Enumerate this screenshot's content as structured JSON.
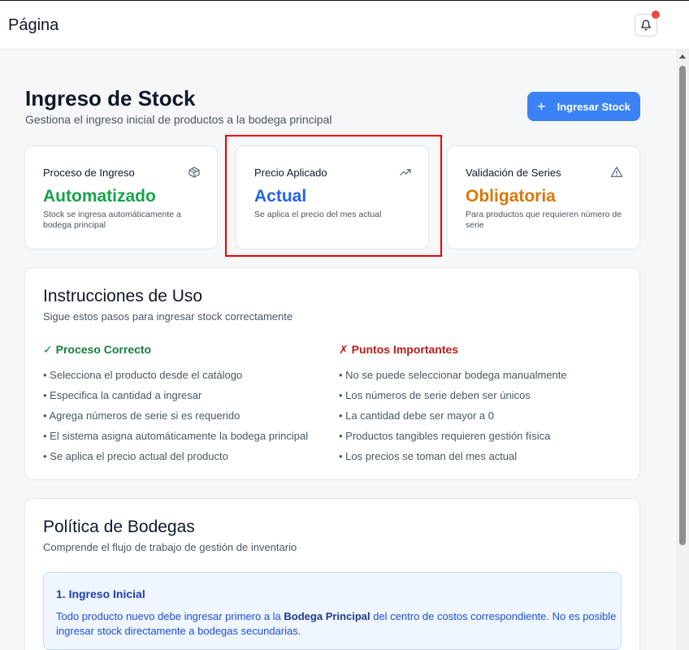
{
  "topbar": {
    "title": "Página"
  },
  "header": {
    "title": "Ingreso de Stock",
    "subtitle": "Gestiona el ingreso inicial de productos a la bodega principal",
    "button_label": "Ingresar Stock"
  },
  "stats": [
    {
      "label": "Proceso de Ingreso",
      "value": "Automatizado",
      "desc": "Stock se ingresa automáticamente a bodega principal",
      "color": "#16a34a",
      "icon": "package-icon"
    },
    {
      "label": "Precio Aplicado",
      "value": "Actual",
      "desc": "Se aplica el precio del mes actual",
      "color": "#2563eb",
      "icon": "trending-up-icon"
    },
    {
      "label": "Validación de Series",
      "value": "Obligatoria",
      "desc": "Para productos que requieren número de serie",
      "color": "#d97706",
      "icon": "warning-icon"
    }
  ],
  "instructions": {
    "title": "Instrucciones de Uso",
    "subtitle": "Sigue estos pasos para ingresar stock correctamente",
    "correct": {
      "heading": "✓ Proceso Correcto",
      "items": [
        "• Selecciona el producto desde el catálogo",
        "• Especifica la cantidad a ingresar",
        "• Agrega números de serie si es requerido",
        "• El sistema asigna automáticamente la bodega principal",
        "• Se aplica el precio actual del producto"
      ]
    },
    "important": {
      "heading": "✗ Puntos Importantes",
      "items": [
        "• No se puede seleccionar bodega manualmente",
        "• Los números de serie deben ser únicos",
        "• La cantidad debe ser mayor a 0",
        "• Productos tangibles requieren gestión física",
        "• Los precios se toman del mes actual"
      ]
    }
  },
  "policy": {
    "title": "Política de Bodegas",
    "subtitle": "Comprende el flujo de trabajo de gestión de inventario",
    "box": {
      "heading": "1. Ingreso Inicial",
      "text_before": "Todo producto nuevo debe ingresar primero a la ",
      "text_bold": "Bodega Principal",
      "text_after": " del centro de costos correspondiente. No es posible ingresar stock directamente a bodegas secundarias."
    }
  },
  "colors": {
    "accent": "#3b82f6",
    "correct": "#15803d",
    "important": "#b91c1c"
  }
}
